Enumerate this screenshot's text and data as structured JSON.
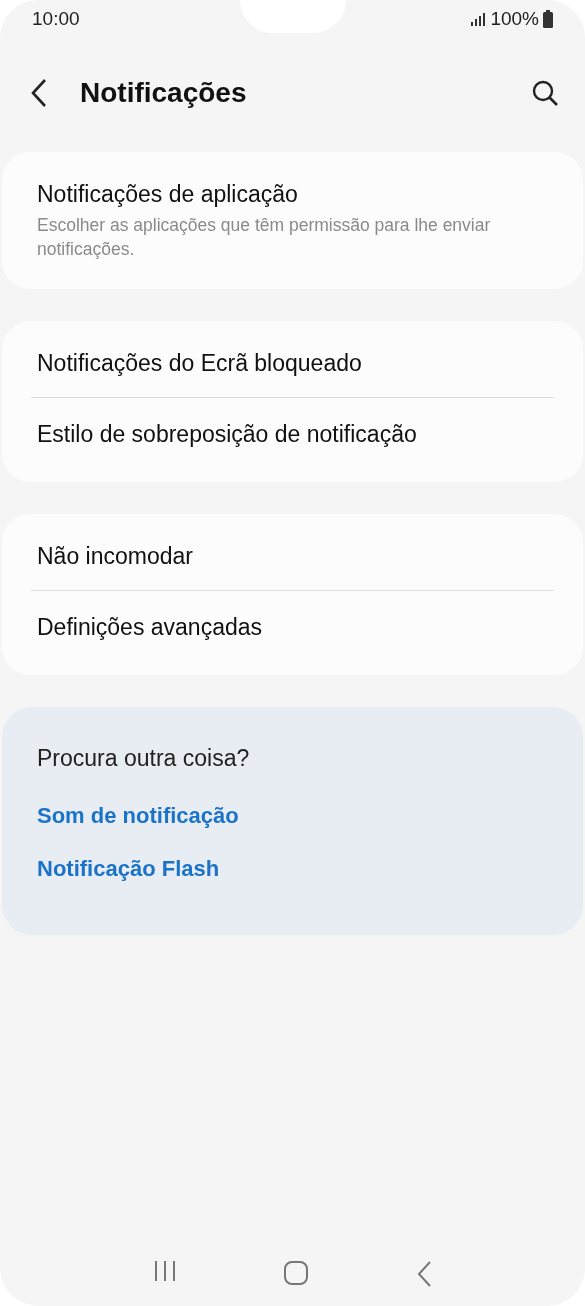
{
  "status_bar": {
    "time": "10:00",
    "battery": "100%"
  },
  "header": {
    "title": "Notificações"
  },
  "groups": [
    {
      "items": [
        {
          "title": "Notificações de aplicação",
          "subtitle": "Escolher as aplicações que têm permissão para lhe enviar notificações."
        }
      ]
    },
    {
      "items": [
        {
          "title": "Notificações do Ecrã bloqueado"
        },
        {
          "title": "Estilo de sobreposição de notificação"
        }
      ]
    },
    {
      "items": [
        {
          "title": "Não incomodar"
        },
        {
          "title": "Definições avançadas"
        }
      ]
    }
  ],
  "suggestions": {
    "title": "Procura outra coisa?",
    "links": [
      "Som de notificação",
      "Notificação Flash"
    ]
  }
}
